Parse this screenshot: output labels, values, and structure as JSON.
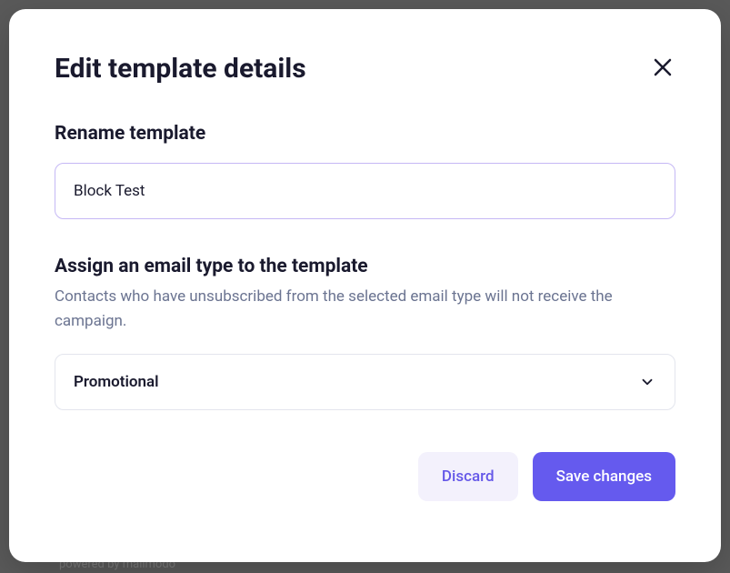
{
  "modal": {
    "title": "Edit template details",
    "rename_section": {
      "label": "Rename template",
      "input_value": "Block Test"
    },
    "email_type_section": {
      "label": "Assign an email type to the template",
      "description": "Contacts who have unsubscribed from the selected email type will not receive the campaign.",
      "selected_value": "Promotional"
    },
    "actions": {
      "discard_label": "Discard",
      "save_label": "Save changes"
    }
  },
  "backdrop": {
    "footer_text": "powered by      mailmodo"
  }
}
